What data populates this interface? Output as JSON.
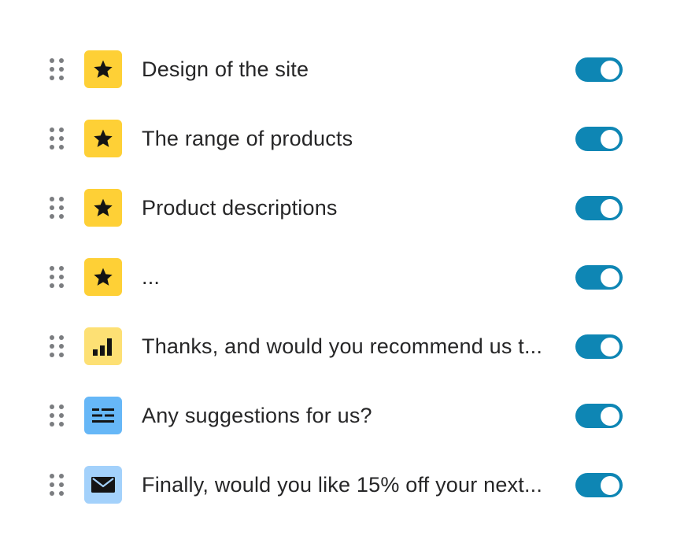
{
  "colors": {
    "rating_icon_bg": "#fed036",
    "nps_icon_bg": "#fde074",
    "text_icon_bg": "#66b7f7",
    "email_icon_bg": "#a3d1fb",
    "toggle_on": "#0e86b4",
    "label_text": "#262627",
    "drag_handle": "#7b7d80"
  },
  "questions": [
    {
      "label": "Design of the site",
      "icon": "star-icon",
      "enabled": true
    },
    {
      "label": "The range of products",
      "icon": "star-icon",
      "enabled": true
    },
    {
      "label": "Product descriptions",
      "icon": "star-icon",
      "enabled": true
    },
    {
      "label": "...",
      "icon": "star-icon",
      "enabled": true
    },
    {
      "label": "Thanks, and would you recommend us t...",
      "icon": "bar-chart-icon",
      "enabled": true
    },
    {
      "label": "Any suggestions for us?",
      "icon": "text-lines-icon",
      "enabled": true
    },
    {
      "label": "Finally, would you like 15% off your next...",
      "icon": "envelope-icon",
      "enabled": true
    }
  ]
}
